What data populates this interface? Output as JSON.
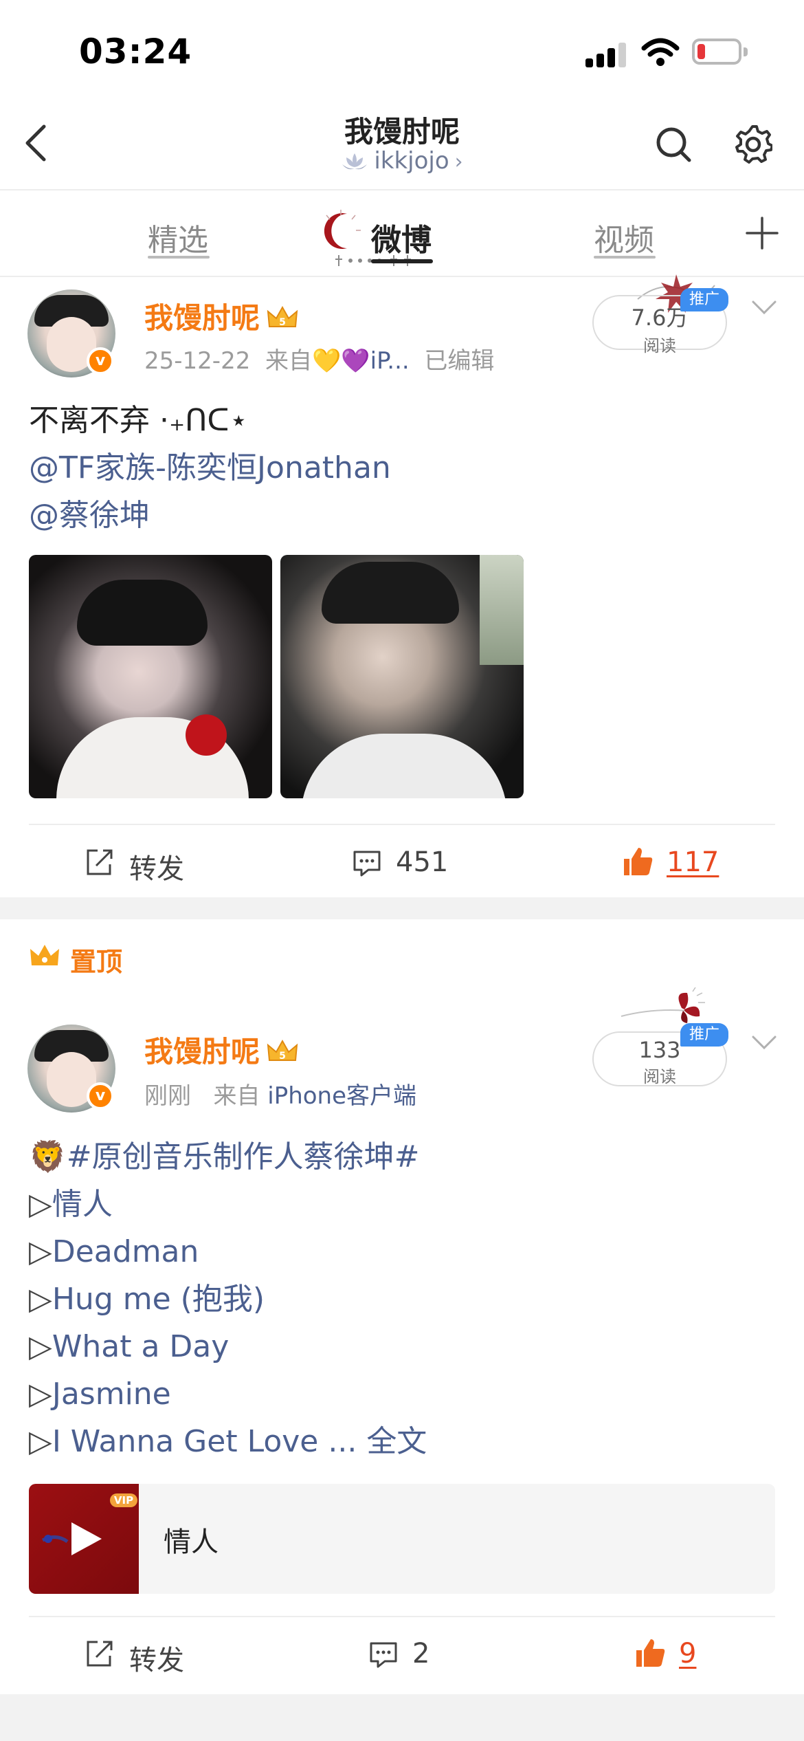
{
  "status_bar": {
    "time": "03:24",
    "battery_level": 0.12
  },
  "header": {
    "title": "我馒肘呢",
    "subtitle": "ikkjojo"
  },
  "tabs": [
    {
      "label": "精选",
      "active": false
    },
    {
      "label": "微博",
      "active": true
    },
    {
      "label": "视频",
      "active": false
    }
  ],
  "posts": [
    {
      "user": "我馒肘呢",
      "meta_date": "25-12-22",
      "meta_from": "来自",
      "meta_source": "💛💜iP...",
      "meta_edited": "已编辑",
      "reads": "7.6万",
      "reads_label": "阅读",
      "promo": "推广",
      "text_line1": "不离不弃 ·₊ᑎᑕ⋆",
      "mention1": "@TF家族-陈奕恒Jonathan",
      "mention2": "@蔡徐坤",
      "repost_label": "转发",
      "comment_count": "451",
      "like_count": "117"
    },
    {
      "pinned_label": "置顶",
      "user": "我馒肘呢",
      "meta_time": "刚刚",
      "meta_from": "来自",
      "meta_source": "iPhone客户端",
      "reads": "133",
      "reads_label": "阅读",
      "promo": "推广",
      "hashtag": "#原创音乐制作人蔡徐坤#",
      "hashtag_emoji": "🦁",
      "tracks": [
        "情人",
        "Deadman",
        "Hug me (抱我)",
        "What a Day",
        "Jasmine",
        "I Wanna Get Love ..."
      ],
      "full_text": "全文",
      "music_title": "情人",
      "music_vip": "VIP",
      "repost_label": "转发",
      "comment_count": "2",
      "like_count": "9"
    }
  ],
  "colors": {
    "username": "#f47a14",
    "link": "#4b5f8f",
    "like": "#e8481f",
    "promo": "#3d8ef0"
  }
}
